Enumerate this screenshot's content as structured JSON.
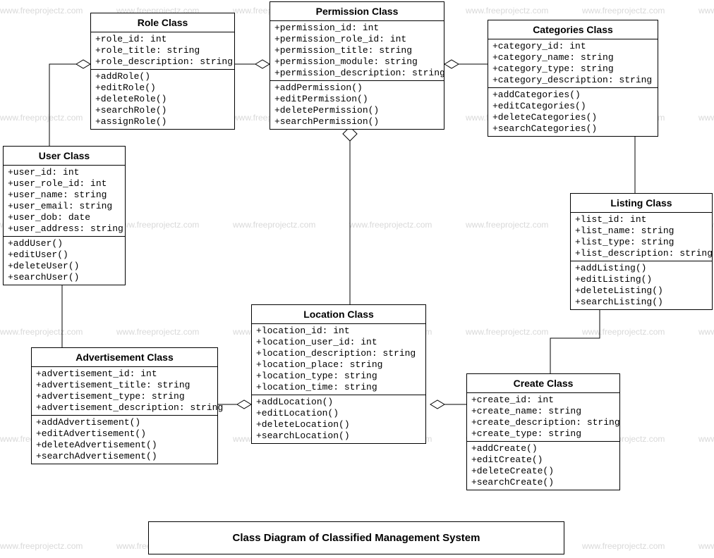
{
  "watermark_text": "www.freeprojectz.com",
  "diagram_title": "Class Diagram of Classified Management System",
  "classes": {
    "role": {
      "name": "Role Class",
      "attrs": [
        "+role_id: int",
        "+role_title: string",
        "+role_description: string"
      ],
      "ops": [
        "+addRole()",
        "+editRole()",
        "+deleteRole()",
        "+searchRole()",
        "+assignRole()"
      ]
    },
    "permission": {
      "name": "Permission Class",
      "attrs": [
        "+permission_id: int",
        "+permission_role_id: int",
        "+permission_title: string",
        "+permission_module: string",
        "+permission_description: string"
      ],
      "ops": [
        "+addPermission()",
        "+editPermission()",
        "+deletePermission()",
        "+searchPermission()"
      ]
    },
    "categories": {
      "name": "Categories Class",
      "attrs": [
        "+category_id: int",
        "+category_name: string",
        "+category_type: string",
        "+category_description: string"
      ],
      "ops": [
        "+addCategories()",
        "+editCategories()",
        "+deleteCategories()",
        "+searchCategories()"
      ]
    },
    "user": {
      "name": "User Class",
      "attrs": [
        "+user_id: int",
        "+user_role_id: int",
        "+user_name: string",
        "+user_email: string",
        "+user_dob: date",
        "+user_address: string"
      ],
      "ops": [
        "+addUser()",
        "+editUser()",
        "+deleteUser()",
        "+searchUser()"
      ]
    },
    "listing": {
      "name": "Listing Class",
      "attrs": [
        "+list_id: int",
        "+list_name: string",
        "+list_type: string",
        "+list_description: string"
      ],
      "ops": [
        "+addListing()",
        "+editListing()",
        "+deleteListing()",
        "+searchListing()"
      ]
    },
    "location": {
      "name": "Location Class",
      "attrs": [
        "+location_id: int",
        "+location_user_id: int",
        "+location_description: string",
        "+location_place: string",
        "+location_type: string",
        "+location_time: string"
      ],
      "ops": [
        "+addLocation()",
        "+editLocation()",
        "+deleteLocation()",
        "+searchLocation()"
      ]
    },
    "advertisement": {
      "name": "Advertisement Class",
      "attrs": [
        "+advertisement_id: int",
        "+advertisement_title: string",
        "+advertisement_type: string",
        "+advertisement_description: string"
      ],
      "ops": [
        "+addAdvertisement()",
        "+editAdvertisement()",
        "+deleteAdvertisement()",
        "+searchAdvertisement()"
      ]
    },
    "create": {
      "name": "Create Class",
      "attrs": [
        "+create_id: int",
        "+create_name: string",
        "+create_description: string",
        "+create_type: string"
      ],
      "ops": [
        "+addCreate()",
        "+editCreate()",
        "+deleteCreate()",
        "+searchCreate()"
      ]
    }
  }
}
